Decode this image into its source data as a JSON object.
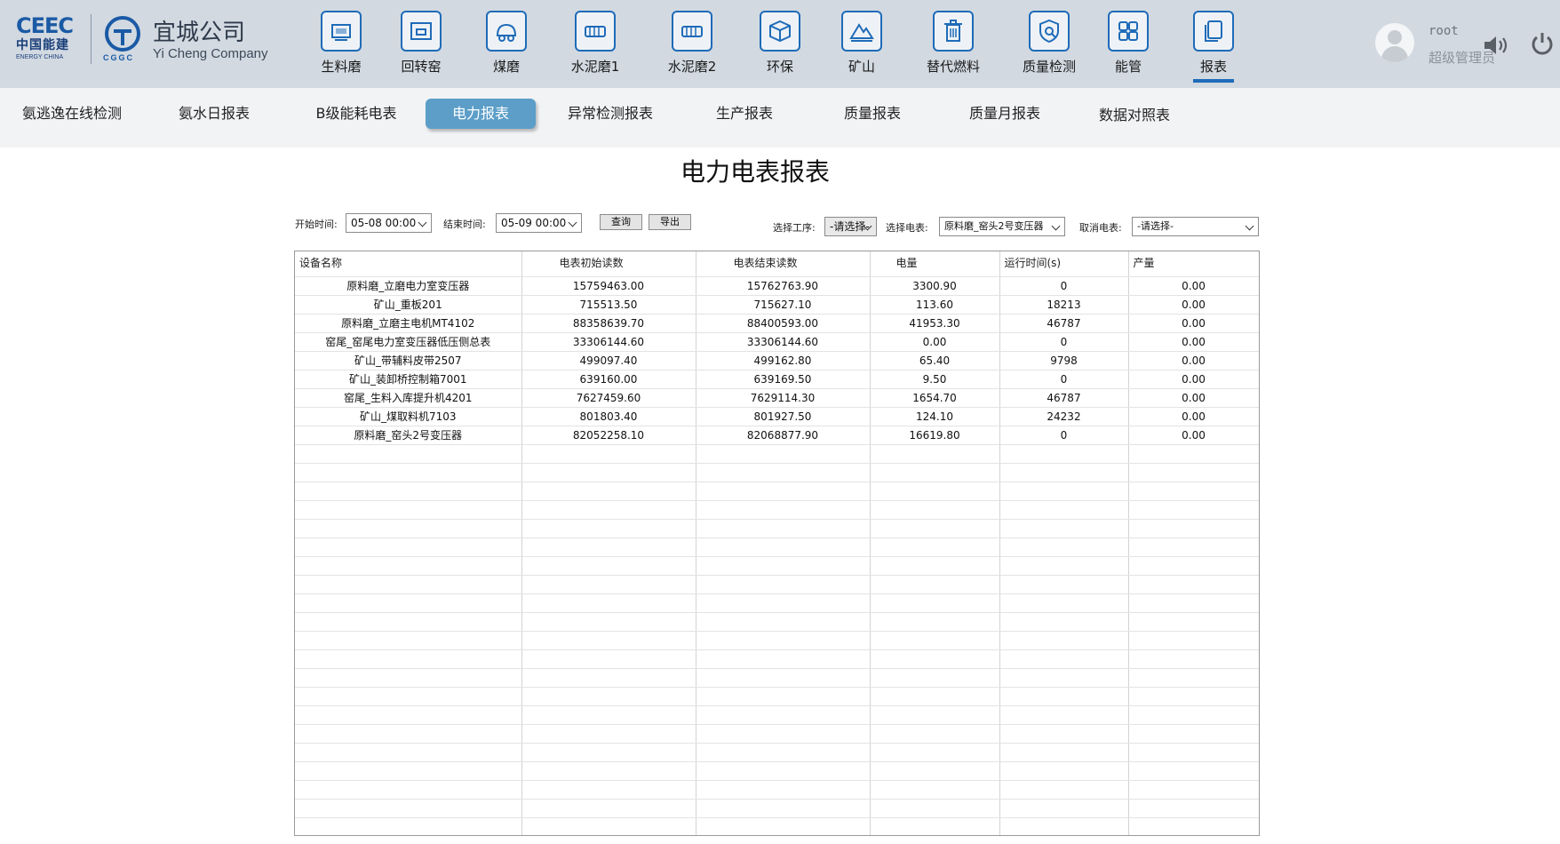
{
  "header": {
    "logo_mark": "CEEC",
    "logo_cn": "中国能建",
    "logo_en": "ENERGY CHINA",
    "cggc_text": "CGGC",
    "company_name": "宜城公司",
    "company_en": "Yi Cheng Company"
  },
  "nav": [
    {
      "label": "生料磨",
      "icon": "raw-mill-icon"
    },
    {
      "label": "回转窑",
      "icon": "kiln-icon"
    },
    {
      "label": "煤磨",
      "icon": "coal-mill-icon"
    },
    {
      "label": "水泥磨1",
      "icon": "cement-mill-icon"
    },
    {
      "label": "水泥磨2",
      "icon": "cement-mill-icon"
    },
    {
      "label": "环保",
      "icon": "box-icon"
    },
    {
      "label": "矿山",
      "icon": "mountain-icon"
    },
    {
      "label": "替代燃料",
      "icon": "trash-icon"
    },
    {
      "label": "质量检测",
      "icon": "shield-search-icon"
    },
    {
      "label": "能管",
      "icon": "grid-icon"
    },
    {
      "label": "报表",
      "icon": "documents-icon",
      "active": true
    }
  ],
  "user": {
    "name": "root",
    "role": "超级管理员"
  },
  "subnav": [
    {
      "label": "氨逃逸在线检测"
    },
    {
      "label": "氨水日报表"
    },
    {
      "label": "B级能耗电表"
    },
    {
      "label": "电力报表",
      "active": true
    },
    {
      "label": "异常检测报表"
    },
    {
      "label": "生产报表"
    },
    {
      "label": "质量报表"
    },
    {
      "label": "质量月报表"
    },
    {
      "label": "数据对照表"
    }
  ],
  "page_title": "电力电表报表",
  "filters": {
    "start_label": "开始时间:",
    "start_value": "05-08 00:00",
    "end_label": "结束时间:",
    "end_value": "05-09 00:00",
    "query_button": "查询",
    "export_button": "导出",
    "process_label": "选择工序:",
    "process_value": "-请选择-",
    "meter_label": "选择电表:",
    "meter_value": "原料磨_窑头2号变压器",
    "cancel_label": "取消电表:",
    "cancel_value": "-请选择-"
  },
  "table": {
    "headers": [
      "设备名称",
      "电表初始读数",
      "电表结束读数",
      "电量",
      "运行时间(s)",
      "产量"
    ],
    "rows": [
      [
        "原料磨_立磨电力室变压器",
        "15759463.00",
        "15762763.90",
        "3300.90",
        "0",
        "0.00"
      ],
      [
        "矿山_重板201",
        "715513.50",
        "715627.10",
        "113.60",
        "18213",
        "0.00"
      ],
      [
        "原料磨_立磨主电机MT4102",
        "88358639.70",
        "88400593.00",
        "41953.30",
        "46787",
        "0.00"
      ],
      [
        "窑尾_窑尾电力室变压器低压侧总表",
        "33306144.60",
        "33306144.60",
        "0.00",
        "0",
        "0.00"
      ],
      [
        "矿山_带辅料皮带2507",
        "499097.40",
        "499162.80",
        "65.40",
        "9798",
        "0.00"
      ],
      [
        "矿山_装卸桥控制箱7001",
        "639160.00",
        "639169.50",
        "9.50",
        "0",
        "0.00"
      ],
      [
        "窑尾_生料入库提升机4201",
        "7627459.60",
        "7629114.30",
        "1654.70",
        "46787",
        "0.00"
      ],
      [
        "矿山_煤取料机7103",
        "801803.40",
        "801927.50",
        "124.10",
        "24232",
        "0.00"
      ],
      [
        "原料磨_窑头2号变压器",
        "82052258.10",
        "82068877.90",
        "16619.80",
        "0",
        "0.00"
      ]
    ]
  },
  "colors": {
    "header_bg": "#d2d9e1",
    "accent": "#1f6bb8",
    "active_tab": "#5c9ec8"
  }
}
